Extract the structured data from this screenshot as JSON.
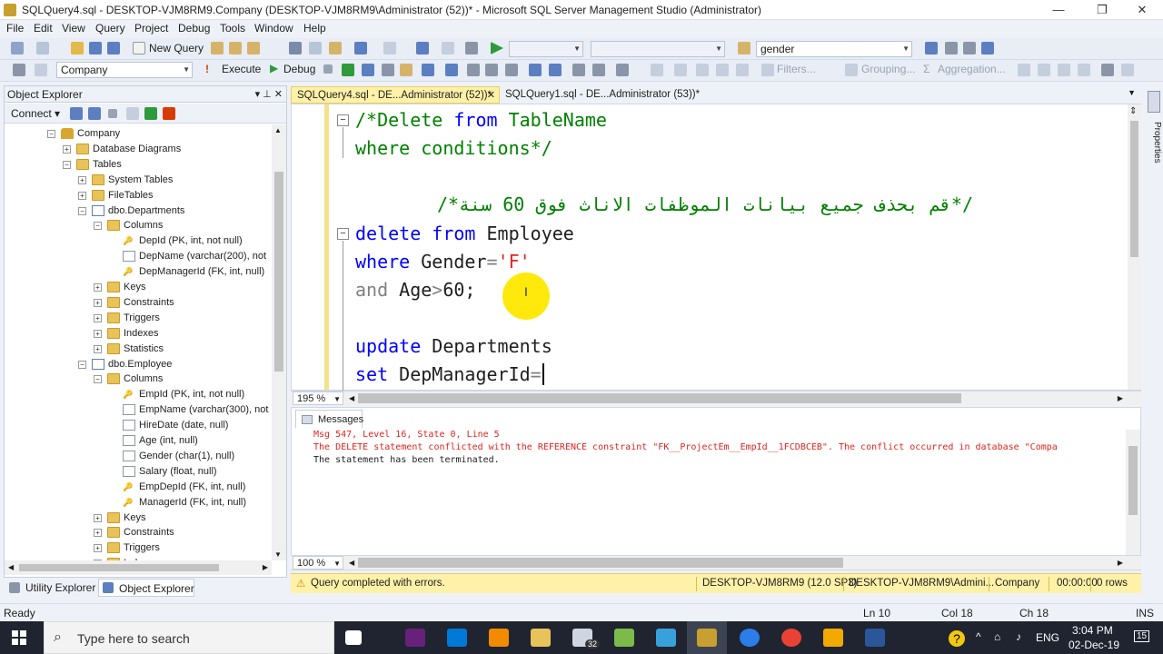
{
  "window": {
    "title": "SQLQuery4.sql - DESKTOP-VJM8RM9.Company (DESKTOP-VJM8RM9\\Administrator (52))* - Microsoft SQL Server Management Studio (Administrator)",
    "min": "—",
    "max": "❐",
    "close": "✕"
  },
  "menu": [
    "File",
    "Edit",
    "View",
    "Query",
    "Project",
    "Debug",
    "Tools",
    "Window",
    "Help"
  ],
  "toolbar1": {
    "new_query": "New Query",
    "search_value": "gender"
  },
  "toolbar2": {
    "database": "Company",
    "execute": "Execute",
    "debug": "Debug",
    "filters": "Filters...",
    "grouping": "Grouping...",
    "aggregation": "Aggregation..."
  },
  "object_explorer": {
    "title": "Object Explorer",
    "pin": "▾ ⊥ ✕",
    "connect": "Connect ▾",
    "tree": [
      {
        "label": "Company",
        "depth": 0,
        "exp": "−",
        "icon": "database-icon"
      },
      {
        "label": "Database Diagrams",
        "depth": 1,
        "exp": "+",
        "icon": "folder-icon"
      },
      {
        "label": "Tables",
        "depth": 1,
        "exp": "−",
        "icon": "folder-icon"
      },
      {
        "label": "System Tables",
        "depth": 2,
        "exp": "+",
        "icon": "folder-icon"
      },
      {
        "label": "FileTables",
        "depth": 2,
        "exp": "+",
        "icon": "folder-icon"
      },
      {
        "label": "dbo.Departments",
        "depth": 2,
        "exp": "−",
        "icon": "table-icon"
      },
      {
        "label": "Columns",
        "depth": 3,
        "exp": "−",
        "icon": "folder-icon"
      },
      {
        "label": "DepId (PK, int, not null)",
        "depth": 4,
        "exp": "",
        "icon": "key-icon"
      },
      {
        "label": "DepName (varchar(200), not",
        "depth": 4,
        "exp": "",
        "icon": "column-icon"
      },
      {
        "label": "DepManagerId (FK, int, null)",
        "depth": 4,
        "exp": "",
        "icon": "key-icon"
      },
      {
        "label": "Keys",
        "depth": 3,
        "exp": "+",
        "icon": "folder-icon"
      },
      {
        "label": "Constraints",
        "depth": 3,
        "exp": "+",
        "icon": "folder-icon"
      },
      {
        "label": "Triggers",
        "depth": 3,
        "exp": "+",
        "icon": "folder-icon"
      },
      {
        "label": "Indexes",
        "depth": 3,
        "exp": "+",
        "icon": "folder-icon"
      },
      {
        "label": "Statistics",
        "depth": 3,
        "exp": "+",
        "icon": "folder-icon"
      },
      {
        "label": "dbo.Employee",
        "depth": 2,
        "exp": "−",
        "icon": "table-icon"
      },
      {
        "label": "Columns",
        "depth": 3,
        "exp": "−",
        "icon": "folder-icon"
      },
      {
        "label": "EmpId (PK, int, not null)",
        "depth": 4,
        "exp": "",
        "icon": "key-icon"
      },
      {
        "label": "EmpName (varchar(300), not",
        "depth": 4,
        "exp": "",
        "icon": "column-icon"
      },
      {
        "label": "HireDate (date, null)",
        "depth": 4,
        "exp": "",
        "icon": "column-icon"
      },
      {
        "label": "Age (int, null)",
        "depth": 4,
        "exp": "",
        "icon": "column-icon"
      },
      {
        "label": "Gender (char(1), null)",
        "depth": 4,
        "exp": "",
        "icon": "column-icon"
      },
      {
        "label": "Salary (float, null)",
        "depth": 4,
        "exp": "",
        "icon": "column-icon"
      },
      {
        "label": "EmpDepId (FK, int, null)",
        "depth": 4,
        "exp": "",
        "icon": "key-icon"
      },
      {
        "label": "ManagerId (FK, int, null)",
        "depth": 4,
        "exp": "",
        "icon": "key-icon"
      },
      {
        "label": "Keys",
        "depth": 3,
        "exp": "+",
        "icon": "folder-icon"
      },
      {
        "label": "Constraints",
        "depth": 3,
        "exp": "+",
        "icon": "folder-icon"
      },
      {
        "label": "Triggers",
        "depth": 3,
        "exp": "+",
        "icon": "folder-icon"
      },
      {
        "label": "Indexes",
        "depth": 3,
        "exp": "+",
        "icon": "folder-icon"
      }
    ]
  },
  "bottom_tabs": {
    "utility": "Utility Explorer",
    "object": "Object Explorer"
  },
  "doc_tabs": {
    "active": "SQLQuery4.sql - DE...Administrator (52))*",
    "active_close": "✕",
    "inactive": "SQLQuery1.sql - DE...Administrator (53))*"
  },
  "editor": {
    "zoom": "195 %",
    "line1_a": "/*Delete ",
    "line1_b": "from",
    "line1_c": " TableName",
    "line2": "where conditions*/",
    "line4": "/*قم بحذف جميع بيانات الموظفات الاناث فوق 60 سنة*/",
    "line5_kw1": "delete",
    "line5_kw2": "from",
    "line5_id": "Employee",
    "line6_kw": "where",
    "line6_id": "Gender",
    "line6_op": "=",
    "line6_str": "'F'",
    "line7_kw": "and",
    "line7_id": "Age",
    "line7_op": ">",
    "line7_num": "60;",
    "line9_kw": "update",
    "line9_id": "Departments",
    "line10_kw": "set",
    "line10_id": "DepManagerId",
    "line10_op": "="
  },
  "messages": {
    "tab": "Messages",
    "zoom": "100 %",
    "line1": "Msg 547, Level 16, State 0, Line 5",
    "line2": "The DELETE statement conflicted with the REFERENCE constraint \"FK__ProjectEm__EmpId__1FCDBCEB\". The conflict occurred in database \"Compa",
    "line3": "The statement has been terminated."
  },
  "query_status": {
    "text": "Query completed with errors.",
    "server": "DESKTOP-VJM8RM9 (12.0 SP3)",
    "user": "DESKTOP-VJM8RM9\\Admini...",
    "db": "Company",
    "time": "00:00:00",
    "rows": "0 rows"
  },
  "status_bar": {
    "ready": "Ready",
    "ln": "Ln 10",
    "col": "Col 18",
    "ch": "Ch 18",
    "ins": "INS"
  },
  "properties_label": "Properties",
  "taskbar": {
    "search": "Type here to search",
    "badge": "32",
    "lang": "ENG",
    "time": "3:04 PM",
    "date": "02-Dec-19",
    "notif": "15"
  },
  "colors": {
    "keyword": "#0000ff",
    "comment": "#008000",
    "string": "#e0241f",
    "operator": "#808080",
    "error": "#e0241f",
    "status_yellow": "#fff1a8"
  }
}
